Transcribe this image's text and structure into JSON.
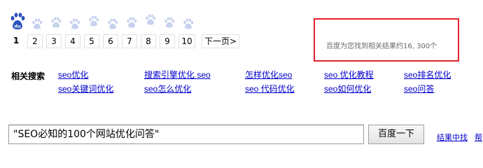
{
  "pagination": {
    "pages": [
      "1",
      "2",
      "3",
      "4",
      "5",
      "6",
      "7",
      "8",
      "9",
      "10"
    ],
    "current": "1",
    "next_label": "下一页>",
    "logo_text": "du",
    "paw_color": "#c8d1ee",
    "logo_color": "#2a52be"
  },
  "result_count": {
    "text": "百度为您找到相关结果约16, 300个",
    "box_color": "#e1202b"
  },
  "related": {
    "title": "相关搜索",
    "links": [
      "seo优化",
      "搜索引擎优化 seo",
      "怎样优化seo",
      "seo 优化教程",
      "seo排名优化",
      "seo关键词优化",
      "seo怎么优化",
      "seo 代码优化",
      "seo如何优化",
      "seo问答"
    ]
  },
  "search": {
    "value": "\"SEO必知的100个网站优化问答\"",
    "button_label": "百度一下",
    "within_results": "结果中找",
    "help": "帮"
  }
}
